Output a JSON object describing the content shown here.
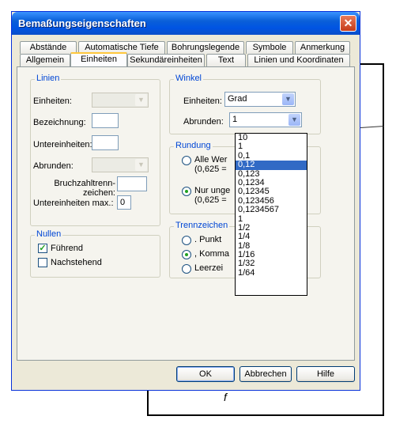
{
  "dialog": {
    "title": "Bemaßungseigenschaften",
    "close": "✕"
  },
  "tabs_row1": [
    "Abstände",
    "Automatische Tiefe",
    "Bohrungslegende",
    "Symbole",
    "Anmerkung"
  ],
  "tabs_row2": [
    "Allgemein",
    "Einheiten",
    "Sekundäreinheiten",
    "Text",
    "Linien und Koordinaten"
  ],
  "linien": {
    "title": "Linien",
    "einheiten_label": "Einheiten:",
    "bezeichnung_label": "Bezeichnung:",
    "untereinheiten_label": "Untereinheiten:",
    "abrunden_label": "Abrunden:",
    "bruchzahl_label": "Bruchzahltrenn-zeichen:",
    "untereinheiten_max_label": "Untereinheiten max.:",
    "untereinheiten_max_value": "0"
  },
  "nullen": {
    "title": "Nullen",
    "fuehrend": "Führend",
    "nachstehend": "Nachstehend"
  },
  "winkel": {
    "title": "Winkel",
    "einheiten_label": "Einheiten:",
    "einheiten_value": "Grad",
    "abrunden_label": "Abrunden:",
    "abrunden_value": "1",
    "options": [
      "10",
      "1",
      "0,1",
      "0,12",
      "0,123",
      "0,1234",
      "0,12345",
      "0,123456",
      "0,1234567",
      "1",
      "1/2",
      "1/4",
      "1/8",
      "1/16",
      "1/32",
      "1/64"
    ],
    "selected_index": 3
  },
  "rundung": {
    "title": "Rundung",
    "alle_werte": "Alle Wer",
    "alle_werte_sub": "(0,625 =",
    "nur_unge": "Nur unge",
    "nur_unge_sub": "(0,625 ="
  },
  "trennzeichen": {
    "title": "Trennzeichen",
    "punkt": ". Punkt",
    "komma": ", Komma",
    "leer": "Leerzei"
  },
  "buttons": {
    "ok": "OK",
    "abbrechen": "Abbrechen",
    "hilfe": "Hilfe"
  },
  "background": {
    "mark": "f"
  },
  "colors": {
    "titlebar": "#0054e3",
    "group_title": "#0046d5",
    "selection": "#316ac5",
    "close": "#c63b1a"
  }
}
